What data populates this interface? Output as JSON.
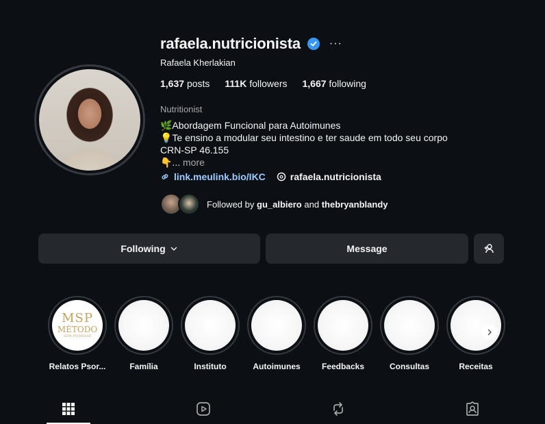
{
  "profile": {
    "username": "rafaela.nutricionista",
    "full_name": "Rafaela Kherlakian",
    "more_glyph": "···",
    "verified": true
  },
  "stats": {
    "posts_count": "1,637",
    "posts_label": "posts",
    "followers_count": "111K",
    "followers_label": "followers",
    "following_count": "1,667",
    "following_label": "following"
  },
  "bio": {
    "category": "Nutritionist",
    "line1": "🌿Abordagem Funcional para Autoimunes",
    "line2": "💡Te ensino a modular seu intestino e ter saude em todo seu corpo",
    "line3": "CRN-SP 46.155",
    "line4_prefix": "👇...",
    "more_label": "more",
    "link": "link.meulink.bio/IKC",
    "threads_handle": "rafaela.nutricionista"
  },
  "followed_by": {
    "prefix": "Followed by",
    "user1": "gu_albiero",
    "and": "and",
    "user2": "thebryanblandy"
  },
  "actions": {
    "following_label": "Following",
    "message_label": "Message"
  },
  "highlights": [
    {
      "label": "Relatos Psor...",
      "cover_text": [
        "MSP",
        "MÉTODO",
        "SEM PSORÍASE"
      ]
    },
    {
      "label": "Família"
    },
    {
      "label": "Instituto"
    },
    {
      "label": "Autoimunes"
    },
    {
      "label": "Feedbacks"
    },
    {
      "label": "Consultas"
    },
    {
      "label": "Receitas"
    }
  ],
  "tabs": [
    "grid-icon",
    "reels-icon",
    "reposts-icon",
    "tagged-icon"
  ],
  "colors": {
    "background": "#0c1014",
    "button": "#25292e",
    "verified": "#3897f0",
    "link": "#9ecbff",
    "msp_gold": "#c6a15b"
  }
}
